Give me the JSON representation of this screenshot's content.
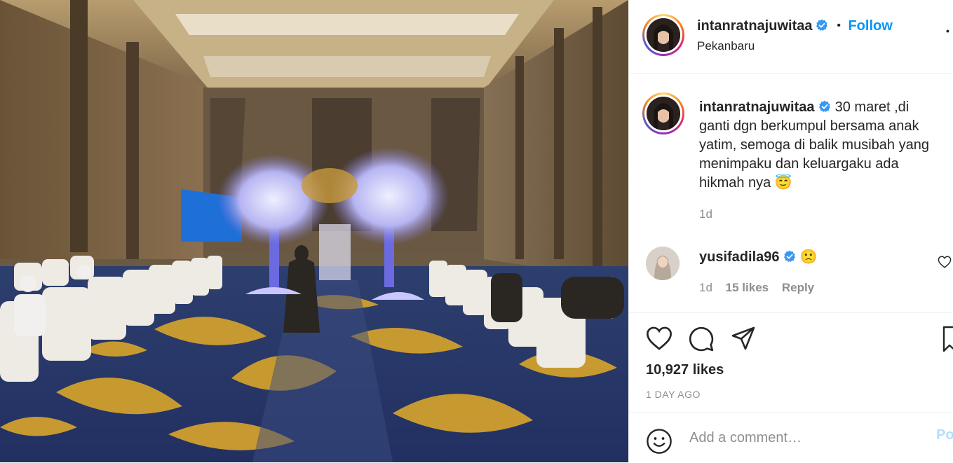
{
  "post": {
    "author": "intanratnajuwitaa",
    "location": "Pekanbaru",
    "follow_label": "Follow",
    "separator": "•",
    "more_label": "•"
  },
  "caption": {
    "username": "intanratnajuwitaa",
    "text_line1": "30 maret ,di",
    "text_line2": "ganti dgn berkumpul bersama anak",
    "text_line3": "yatim, semoga di balik musibah yang",
    "text_line4": "menimpaku dan keluargaku ada",
    "text_line5": "hikmah nya",
    "emoji": "😇",
    "time": "1d"
  },
  "comments": [
    {
      "username": "yusifadila96",
      "emoji": "🙁",
      "time": "1d",
      "likes": "15 likes",
      "reply_label": "Reply"
    }
  ],
  "actions": {
    "likes_count": "10,927 likes",
    "time_ago": "1 DAY AGO"
  },
  "comment_box": {
    "placeholder": "Add a comment…",
    "post_label": "Po"
  },
  "colors": {
    "accent": "#0095f6",
    "verified": "#3897f0",
    "muted": "#8e8e8e"
  }
}
